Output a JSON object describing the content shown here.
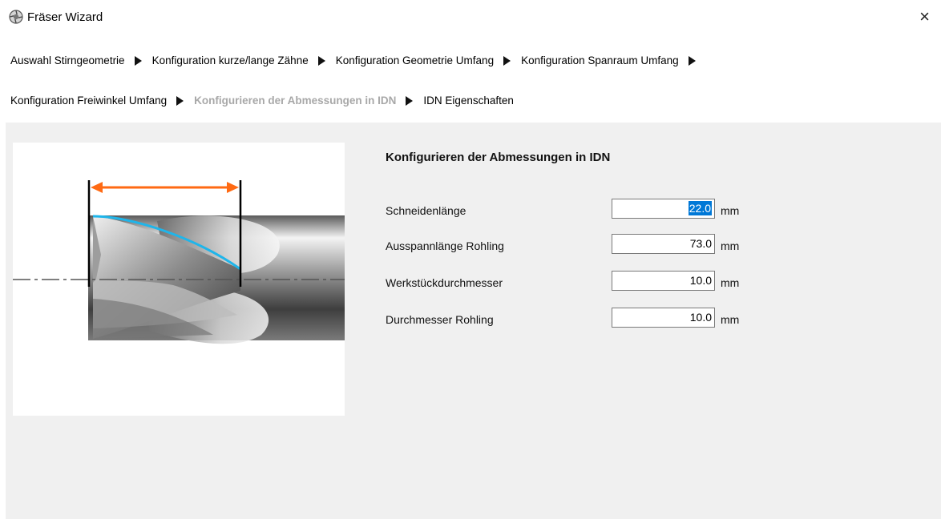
{
  "window": {
    "title": "Fräser Wizard",
    "close_glyph": "×",
    "icon": "wizard-app-icon"
  },
  "breadcrumb": {
    "steps": [
      {
        "label": "Auswahl Stirngeometrie"
      },
      {
        "label": "Konfiguration kurze/lange Zähne"
      },
      {
        "label": "Konfiguration Geometrie Umfang"
      },
      {
        "label": "Konfiguration Spanraum Umfang"
      },
      {
        "label": "Konfiguration Freiwinkel Umfang"
      },
      {
        "label": "Konfigurieren der Abmessungen in IDN",
        "active": true
      },
      {
        "label": "IDN Eigenschaften"
      }
    ]
  },
  "form": {
    "title": "Konfigurieren der Abmessungen in IDN",
    "fields": [
      {
        "label": "Schneidenlänge",
        "value": "22.0",
        "unit": "mm",
        "selected": true
      },
      {
        "label": "Ausspannlänge Rohling",
        "value": "73.0",
        "unit": "mm"
      },
      {
        "label": "Werkstückdurchmesser",
        "value": "10.0",
        "unit": "mm"
      },
      {
        "label": "Durchmesser Rohling",
        "value": "10.0",
        "unit": "mm"
      }
    ]
  },
  "colors": {
    "dimension_arrow": "#ff6a13",
    "cutting_edge": "#1fb5ea",
    "panel": "#f0f0f0",
    "active_step": "#a8a8a8"
  }
}
